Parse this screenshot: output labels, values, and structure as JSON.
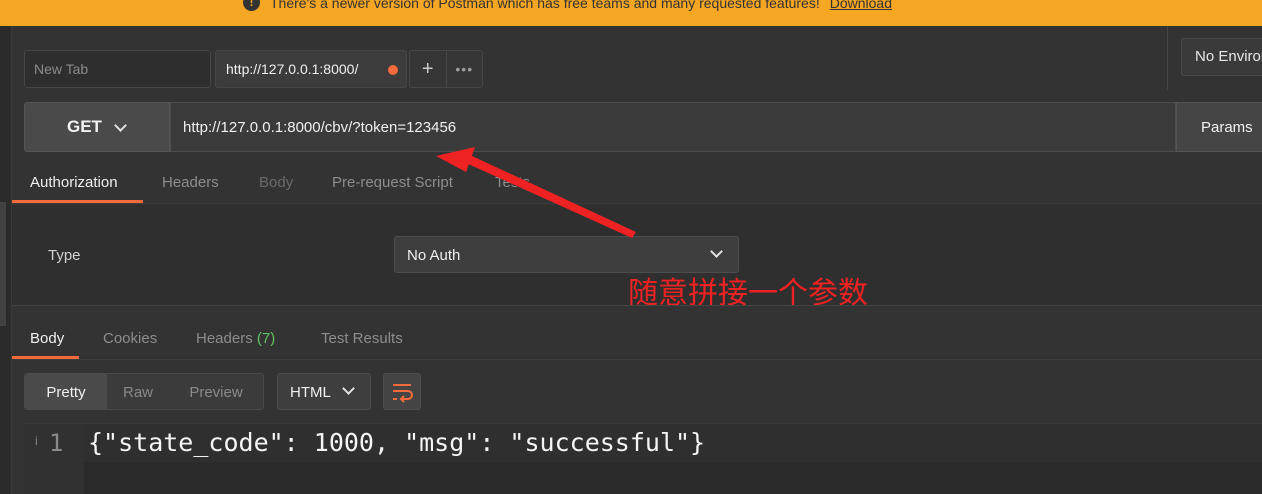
{
  "banner": {
    "message": "There's a newer version of Postman which has free teams and many requested features!",
    "download_label": "Download",
    "color": "#f5a623"
  },
  "tabs": {
    "new_tab_placeholder": "New Tab",
    "active_tab_title": "http://127.0.0.1:8000/",
    "unsaved_dot_color": "#f26b3a",
    "add_icon": "plus-icon",
    "more_icon": "more-icon"
  },
  "environment": {
    "selected": "No Environment"
  },
  "request": {
    "method": "GET",
    "url": "http://127.0.0.1:8000/cbv/?token=123456",
    "params_label": "Params"
  },
  "request_tabs": [
    {
      "label": "Authorization",
      "active": true
    },
    {
      "label": "Headers",
      "active": false
    },
    {
      "label": "Body",
      "active": false
    },
    {
      "label": "Pre-request Script",
      "active": false
    },
    {
      "label": "Tests",
      "active": false
    }
  ],
  "auth": {
    "type_label": "Type",
    "type_value": "No Auth"
  },
  "annotation": {
    "text": "随意拼接一个参数",
    "color": "#ee2222"
  },
  "response_tabs": [
    {
      "label": "Body",
      "active": true
    },
    {
      "label": "Cookies",
      "active": false
    },
    {
      "label": "Headers",
      "count": "(7)",
      "active": false
    },
    {
      "label": "Test Results",
      "active": false
    }
  ],
  "response_view": {
    "modes": [
      "Pretty",
      "Raw",
      "Preview"
    ],
    "active_mode": "Pretty",
    "format": "HTML",
    "wrap_icon": "wrap-lines-icon"
  },
  "response_body": {
    "line_number": "1",
    "content": "{\"state_code\": 1000, \"msg\": \"successful\"}"
  },
  "accent_color": "#f26b3a"
}
